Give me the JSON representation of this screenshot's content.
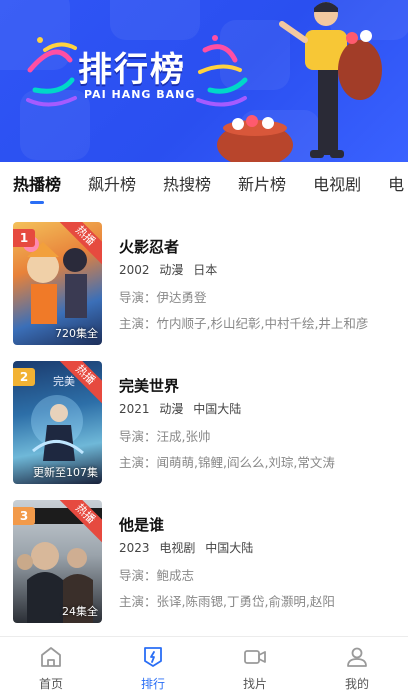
{
  "banner": {
    "title": "排行榜",
    "subtitle": "PAI HANG BANG"
  },
  "tabs": [
    {
      "label": "热播榜",
      "active": true
    },
    {
      "label": "飙升榜",
      "active": false
    },
    {
      "label": "热搜榜",
      "active": false
    },
    {
      "label": "新片榜",
      "active": false
    },
    {
      "label": "电视剧",
      "active": false
    },
    {
      "label": "电",
      "active": false
    }
  ],
  "items": [
    {
      "rank": "1",
      "rank_color": "#e64a3f",
      "badge": "热播",
      "episodes": "720集全",
      "title": "火影忍者",
      "year": "2002",
      "genre": "动漫",
      "region": "日本",
      "director": "导演：伊达勇登",
      "cast": "主演：竹内顺子,杉山纪彰,中村千绘,井上和彦"
    },
    {
      "rank": "2",
      "rank_color": "#f2b233",
      "badge": "热播",
      "episodes": "更新至107集",
      "title": "完美世界",
      "year": "2021",
      "genre": "动漫",
      "region": "中国大陆",
      "director": "导演：汪成,张帅",
      "cast": "主演：闻萌萌,锦鲤,阎么么,刘琮,常文涛"
    },
    {
      "rank": "3",
      "rank_color": "#f29a4a",
      "badge": "热播",
      "episodes": "24集全",
      "title": "他是谁",
      "year": "2023",
      "genre": "电视剧",
      "region": "中国大陆",
      "director": "导演：鲍成志",
      "cast": "主演：张译,陈雨锶,丁勇岱,俞灏明,赵阳"
    }
  ],
  "nav": [
    {
      "label": "首页",
      "icon": "home-icon",
      "active": false
    },
    {
      "label": "排行",
      "icon": "ranking-icon",
      "active": true
    },
    {
      "label": "找片",
      "icon": "video-camera-icon",
      "active": false
    },
    {
      "label": "我的",
      "icon": "user-icon",
      "active": false
    }
  ],
  "colors": {
    "accent": "#2a6ef5",
    "banner_bg": "#2f55f5",
    "hot_badge": "#e64a3f"
  }
}
